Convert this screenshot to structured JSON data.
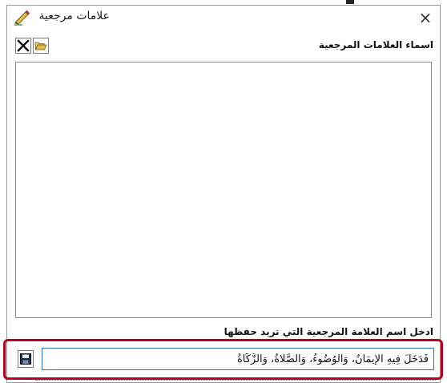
{
  "window": {
    "title": "علامات مرجعية",
    "close_glyph": "×",
    "title_icon": "pen-icon"
  },
  "toolbar": {
    "delete_icon": "close-icon",
    "open_icon": "folder-open-icon",
    "names_label": "اسماء العلامات المرجعية"
  },
  "bookmarks": {
    "items": []
  },
  "entry": {
    "label": "ادخل اسم العلامة المرجعية التي تريد حفظها",
    "value": "فَدَخَلَ فِيهِ الإِيمَانُ، وَالوُضُوءُ، وَالصَّلَاةُ، وَالزَّكَاةُ",
    "save_icon": "save-icon"
  },
  "colors": {
    "highlight": "#b8001c",
    "input_border": "#2a6fdb"
  }
}
